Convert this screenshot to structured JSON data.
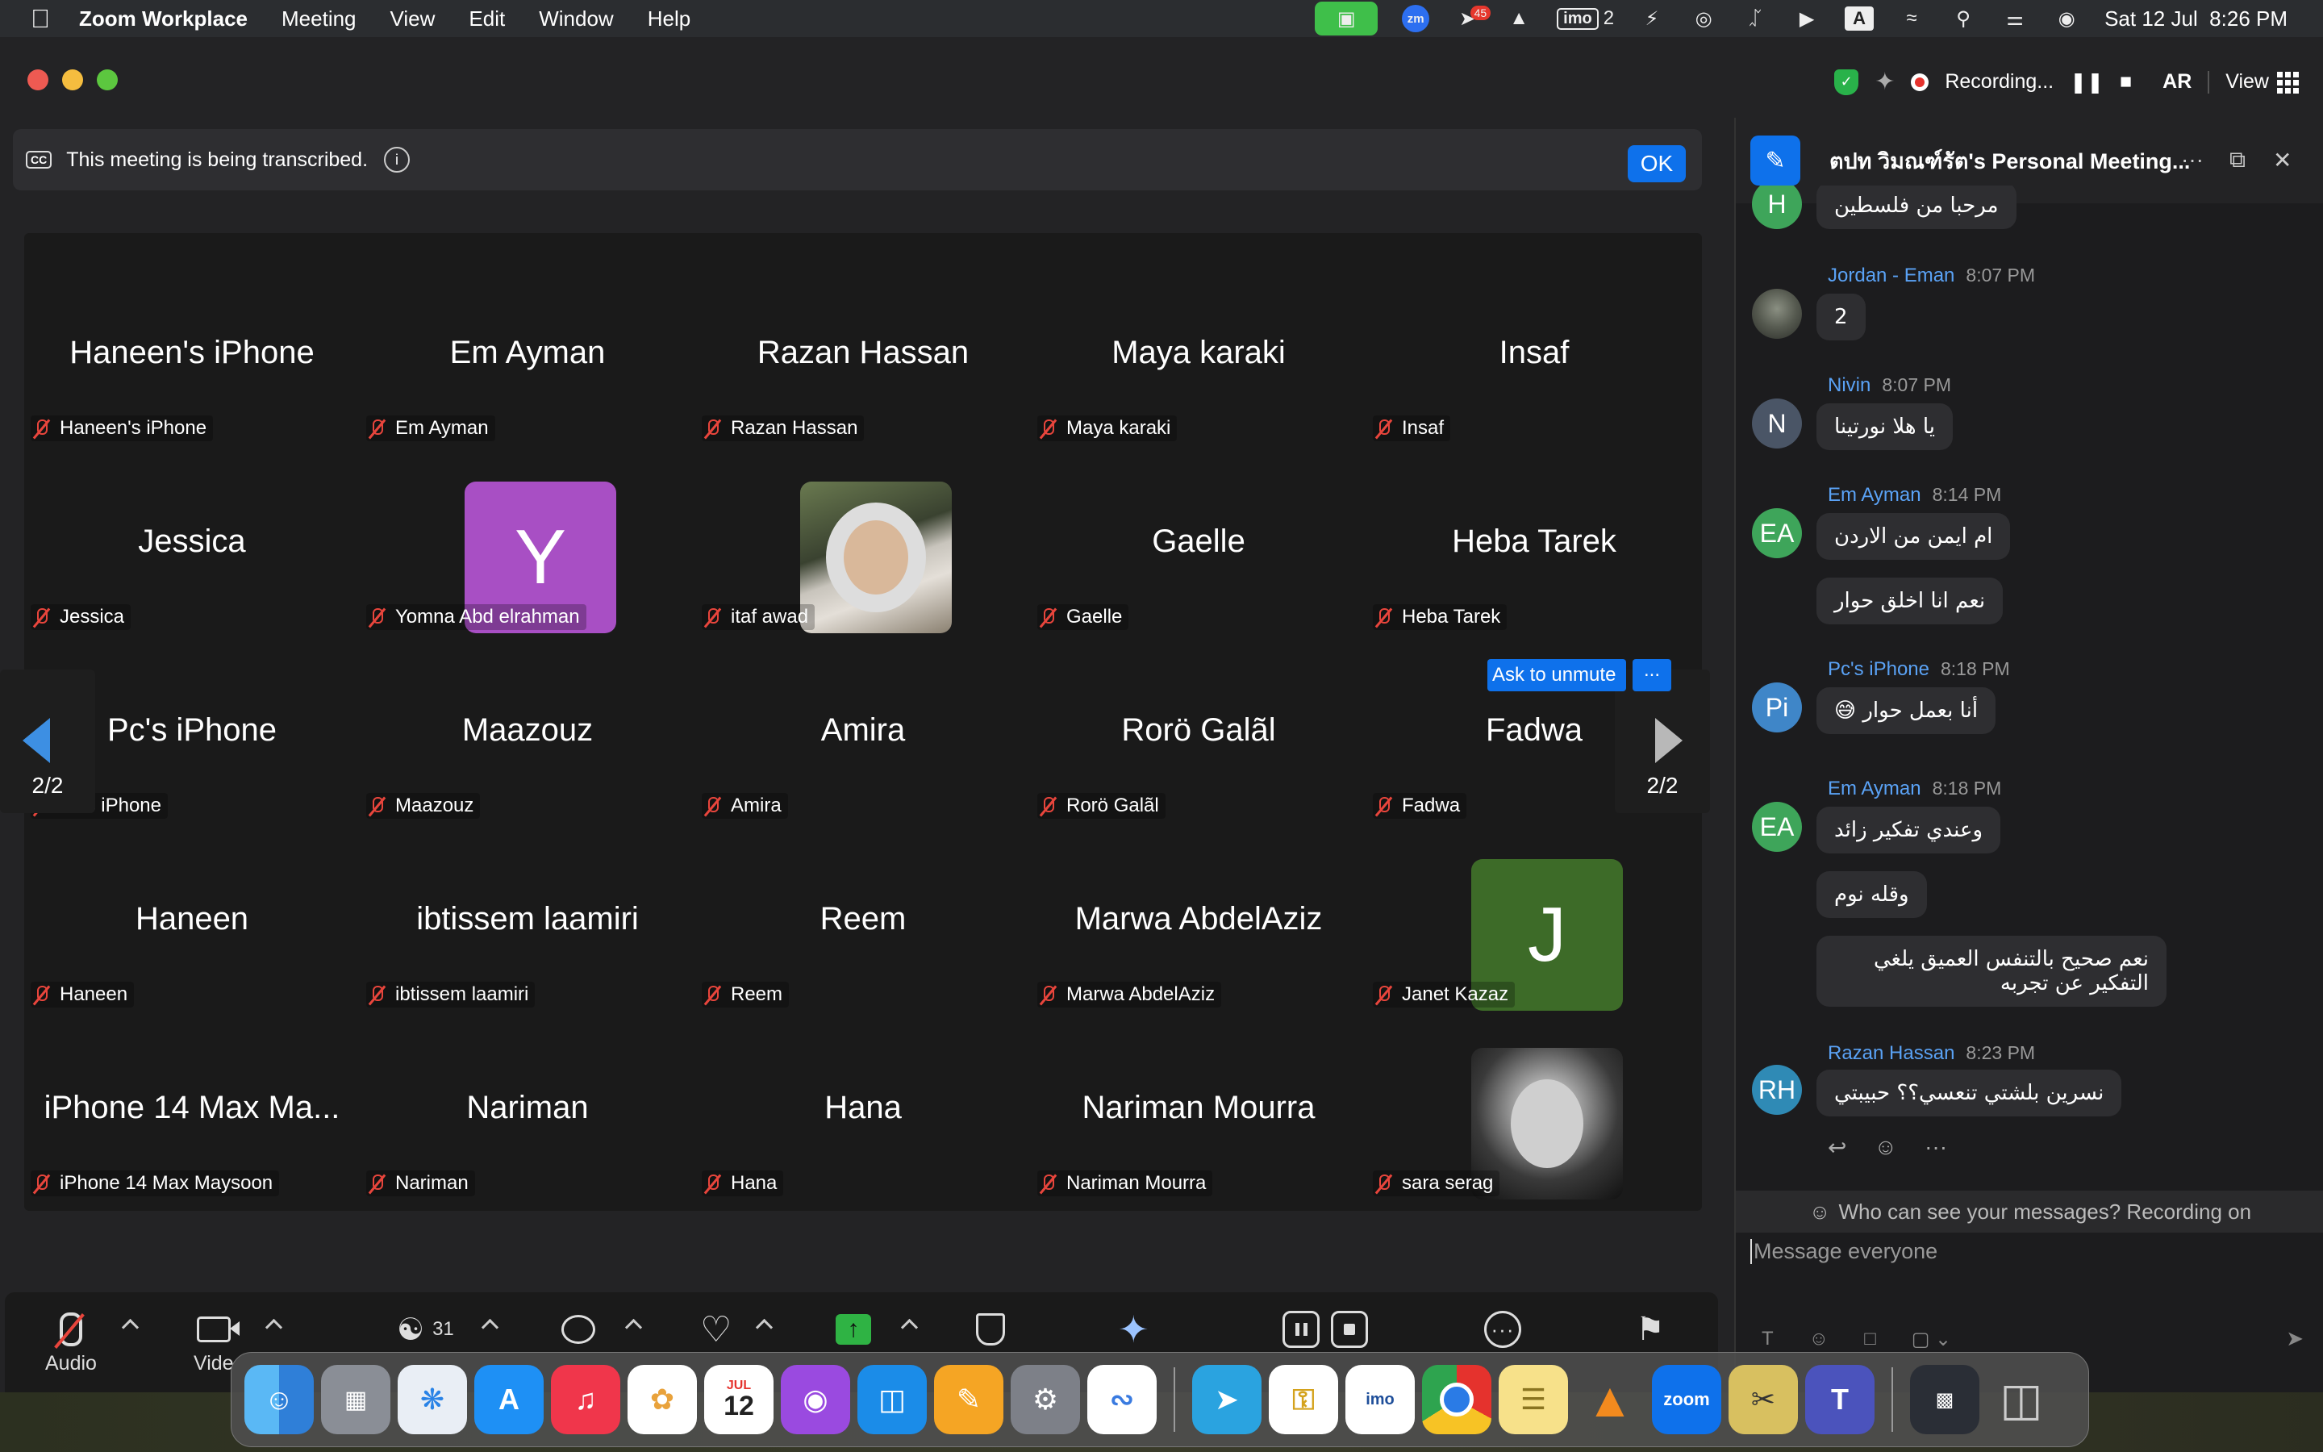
{
  "menubar": {
    "app_name": "Zoom Workplace",
    "menus": [
      "Meeting",
      "View",
      "Edit",
      "Window",
      "Help"
    ],
    "status_icons": [
      "zoom-video-icon",
      "zm-icon",
      "telegram-icon",
      "vlc-icon",
      "imo-icon",
      "battery-icon",
      "airdrop-icon",
      "bluetooth-icon",
      "play-icon",
      "input-source-icon",
      "wifi-icon",
      "spotlight-icon",
      "control-center-icon",
      "siri-icon"
    ],
    "zm_label": "zm",
    "telegram_badge": "45",
    "imo_label": "imo",
    "imo_count": "2",
    "input_source": "A",
    "datetime": "Sat 12 Jul  8:26 PM"
  },
  "titlebar": {
    "recording_label": "Recording...",
    "language": "AR",
    "view_label": "View"
  },
  "banner": {
    "cc": "CC",
    "text": "This meeting is being transcribed.",
    "ok_label": "OK"
  },
  "gallery": {
    "page_indicator": "2/2",
    "ask_to_unmute": "Ask to unmute",
    "ask_more": "...",
    "tiles": [
      {
        "display": "Haneen's iPhone",
        "label": "Haneen's iPhone"
      },
      {
        "display": "Em Ayman",
        "label": "Em Ayman"
      },
      {
        "display": "Razan Hassan",
        "label": "Razan Hassan"
      },
      {
        "display": "Maya karaki",
        "label": "Maya karaki"
      },
      {
        "display": "Insaf",
        "label": "Insaf"
      },
      {
        "display": "Jessica",
        "label": "Jessica"
      },
      {
        "display": "Y",
        "label": "Yomna Abd elrahman"
      },
      {
        "display": "",
        "label": "itaf awad"
      },
      {
        "display": "Gaelle",
        "label": "Gaelle"
      },
      {
        "display": "Heba Tarek",
        "label": "Heba Tarek"
      },
      {
        "display": "Pc's iPhone",
        "label": "Pc's iPhone"
      },
      {
        "display": "Maazouz",
        "label": "Maazouz"
      },
      {
        "display": "Amira",
        "label": "Amira"
      },
      {
        "display": "Rorö Galãl",
        "label": "Rorö Galãl"
      },
      {
        "display": "Fadwa",
        "label": "Fadwa"
      },
      {
        "display": "Haneen",
        "label": "Haneen"
      },
      {
        "display": "ibtissem laamiri",
        "label": "ibtissem laamiri"
      },
      {
        "display": "Reem",
        "label": "Reem"
      },
      {
        "display": "Marwa AbdelAziz",
        "label": "Marwa AbdelAziz"
      },
      {
        "display": "J",
        "label": "Janet Kazaz"
      },
      {
        "display": "iPhone 14 Max Ma...",
        "label": "iPhone 14 Max Maysoon"
      },
      {
        "display": "Nariman",
        "label": "Nariman"
      },
      {
        "display": "Hana",
        "label": "Hana"
      },
      {
        "display": "Nariman Mourra",
        "label": "Nariman Mourra"
      },
      {
        "display": "",
        "label": "sara serag"
      }
    ]
  },
  "toolbar": {
    "audio_label": "Audio",
    "video_label": "Video",
    "participants_count": "31"
  },
  "chat": {
    "title": "ตปท วิมณฑ์รัต's Personal Meeting...",
    "messages": [
      {
        "initials": "H",
        "text": "مرحبا من فلسطين"
      },
      {
        "sender": "Jordan - Eman",
        "time": "8:07 PM",
        "text": "2"
      },
      {
        "initials": "N",
        "sender": "Nivin",
        "time": "8:07 PM",
        "text": "يا هلا نورتينا"
      },
      {
        "initials": "EA",
        "sender": "Em Ayman",
        "time": "8:14 PM",
        "text": "ام ايمن من الاردن",
        "text2": "نعم انا اخلق حوار"
      },
      {
        "initials": "Pi",
        "sender": "Pc's iPhone",
        "time": "8:18 PM",
        "text": "أنا بعمل حوار 😅"
      },
      {
        "initials": "EA",
        "sender": "Em Ayman",
        "time": "8:18 PM",
        "text": "وعندي تفكير زائد",
        "text2": "وقله نوم",
        "text3": "نعم صحيح بالتنفس العميق يلغي التفكير عن تجربه"
      },
      {
        "initials": "RH",
        "sender": "Razan Hassan",
        "time": "8:23 PM",
        "text": "نسرين بلشتي تنعسي؟؟ حبيبتي"
      }
    ],
    "visibility_note": "Who can see your messages? Recording on",
    "compose_placeholder": "Message everyone"
  },
  "dock": {
    "calendar_month": "JUL",
    "calendar_day": "12",
    "zoom_label": "zoom",
    "imo_label": "imo"
  },
  "colors": {
    "accent_blue": "#0e71eb",
    "mute_red": "#e8453c",
    "share_green": "#2fb344",
    "avatar_purple": "#a84fc4",
    "avatar_green": "#3d6b28"
  }
}
